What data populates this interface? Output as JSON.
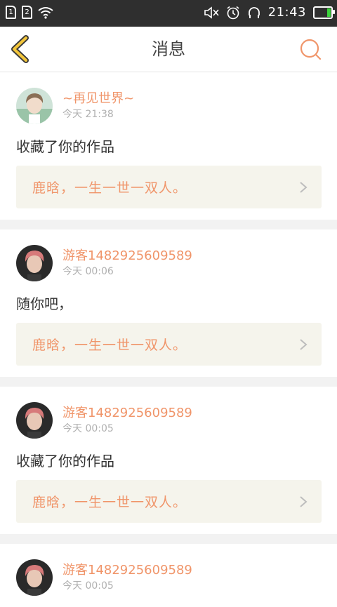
{
  "status_bar": {
    "sim1": "1",
    "sim2": "2",
    "time": "21:43",
    "icons": [
      "wifi-icon",
      "mute-icon",
      "alarm-icon",
      "headset-icon",
      "battery-icon"
    ]
  },
  "header": {
    "title": "消息",
    "back_icon": "chevron-left-icon",
    "search_icon": "search-icon"
  },
  "colors": {
    "accent": "#f0956a",
    "back_arrow": "#e8b830",
    "link_bg": "#f5f4ec"
  },
  "messages": [
    {
      "username": "~再见世界~",
      "time": "今天 21:38",
      "action": "收藏了你的作品",
      "work": "鹿晗，一生一世一双人。"
    },
    {
      "username": "游客1482925609589",
      "time": "今天 00:06",
      "action": "随你吧，",
      "work": "鹿晗，一生一世一双人。"
    },
    {
      "username": "游客1482925609589",
      "time": "今天 00:05",
      "action": "收藏了你的作品",
      "work": "鹿晗，一生一世一双人。"
    },
    {
      "username": "游客1482925609589",
      "time": "今天 00:05"
    }
  ]
}
